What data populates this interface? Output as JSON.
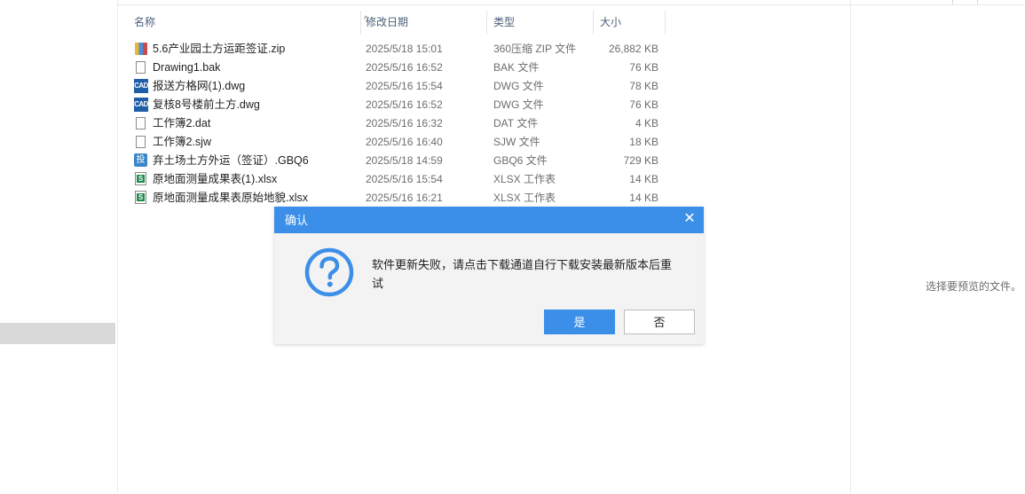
{
  "columns": {
    "name": "名称",
    "date": "修改日期",
    "type": "类型",
    "size": "大小",
    "sort_indicator": "^"
  },
  "files": [
    {
      "icon": "zip-archive-icon",
      "name": "5.6产业园土方运距签证.zip",
      "date": "2025/5/18 15:01",
      "type": "360压缩 ZIP 文件",
      "size": "26,882 KB"
    },
    {
      "icon": "document-icon",
      "name": "Drawing1.bak",
      "date": "2025/5/16 16:52",
      "type": "BAK 文件",
      "size": "76 KB"
    },
    {
      "icon": "cad-file-icon",
      "name": "报送方格网(1).dwg",
      "date": "2025/5/16 15:54",
      "type": "DWG 文件",
      "size": "78 KB"
    },
    {
      "icon": "cad-file-icon",
      "name": "复核8号楼前土方.dwg",
      "date": "2025/5/16 16:52",
      "type": "DWG 文件",
      "size": "76 KB"
    },
    {
      "icon": "document-icon",
      "name": "工作簿2.dat",
      "date": "2025/5/16 16:32",
      "type": "DAT 文件",
      "size": "4 KB"
    },
    {
      "icon": "document-icon",
      "name": "工作簿2.sjw",
      "date": "2025/5/16 16:40",
      "type": "SJW 文件",
      "size": "18 KB"
    },
    {
      "icon": "gbq-file-icon",
      "name": "弃土场土方外运（签证）.GBQ6",
      "date": "2025/5/18 14:59",
      "type": "GBQ6 文件",
      "size": "729 KB"
    },
    {
      "icon": "spreadsheet-icon",
      "name": "原地面测量成果表(1).xlsx",
      "date": "2025/5/16 15:54",
      "type": "XLSX 工作表",
      "size": "14 KB"
    },
    {
      "icon": "spreadsheet-icon",
      "name": "原地面测量成果表原始地貌.xlsx",
      "date": "2025/5/16 16:21",
      "type": "XLSX 工作表",
      "size": "14 KB"
    }
  ],
  "preview": {
    "empty_text": "选择要预览的文件。"
  },
  "dialog": {
    "title": "确认",
    "close_glyph": "✕",
    "icon": "question-icon",
    "message": "软件更新失败，请点击下载通道自行下载安装最新版本后重试",
    "yes_label": "是",
    "no_label": "否",
    "accent_color": "#3b8fe8"
  }
}
